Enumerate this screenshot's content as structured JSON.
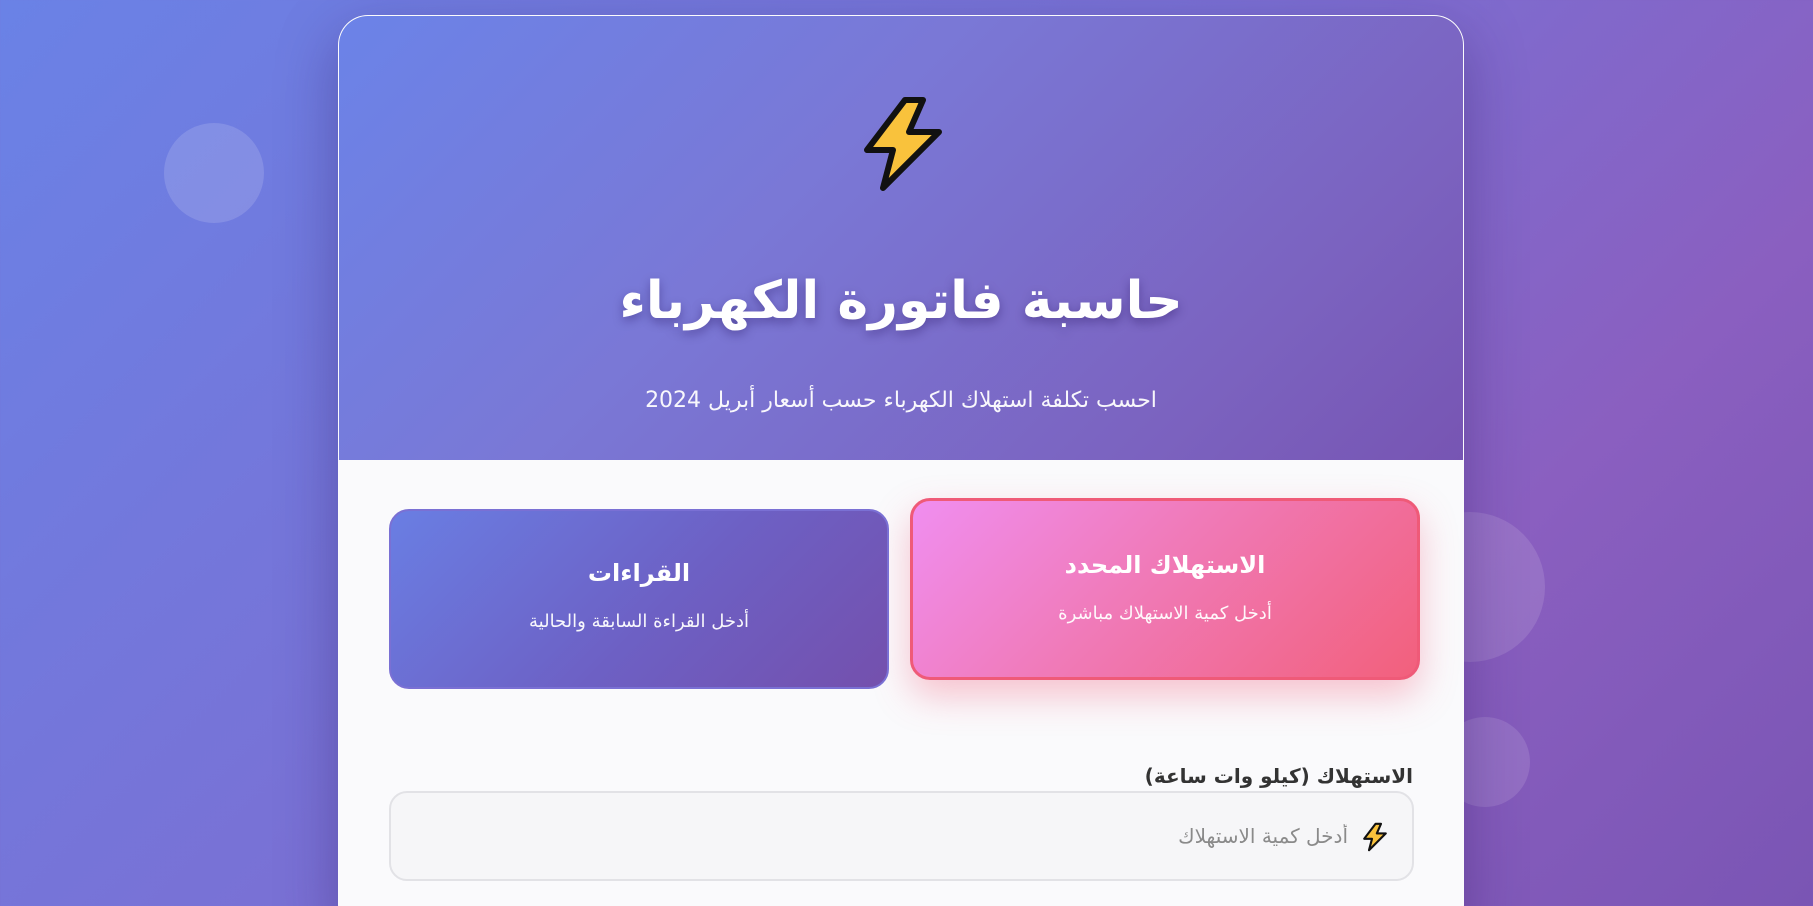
{
  "header": {
    "title": "حاسبة فاتورة الكهرباء",
    "subtitle": "احسب تكلفة استهلاك الكهرباء حسب أسعار أبريل 2024",
    "icon": "lightning-bolt-icon"
  },
  "modes": [
    {
      "title": "الاستهلاك المحدد",
      "description": "أدخل كمية الاستهلاك مباشرة",
      "selected": true
    },
    {
      "title": "القراءات",
      "description": "أدخل القراءة السابقة والحالية",
      "selected": false
    }
  ],
  "consumption_field": {
    "label": "الاستهلاك (كيلو وات ساعة)",
    "placeholder": "أدخل كمية الاستهلاك",
    "value": "",
    "icon": "lightning-bolt-icon"
  },
  "colors": {
    "accent_start": "#667eea",
    "accent_end": "#764ba2",
    "selected_start": "#f093fb",
    "selected_end": "#f5576c",
    "bolt_fill": "#f9c23c"
  }
}
